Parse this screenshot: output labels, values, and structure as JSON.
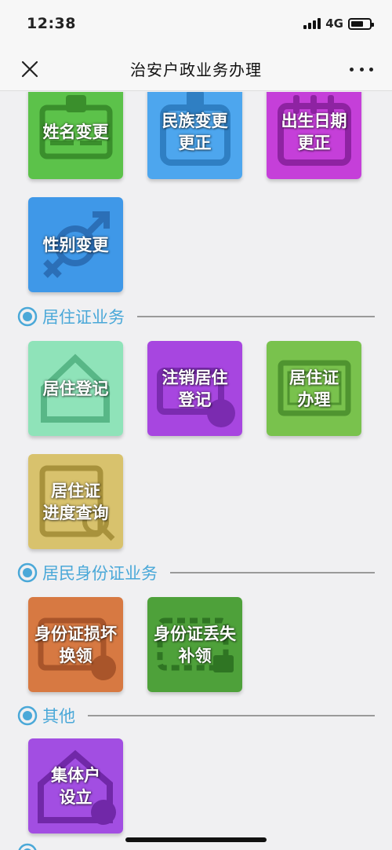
{
  "status": {
    "time": "12:38",
    "network": "4G"
  },
  "nav": {
    "title": "治安户政业务办理"
  },
  "tiles_name": [
    {
      "label": "姓名变更",
      "color": "#5cc24a",
      "icon": "id-card-icon"
    },
    {
      "label": "民族变更\n更正",
      "color": "#4da6ee",
      "icon": "badge-icon"
    },
    {
      "label": "出生日期\n更正",
      "color": "#c53fd9",
      "icon": "calendar-icon"
    },
    {
      "label": "性别变更",
      "color": "#3f98e8",
      "icon": "gender-icon"
    }
  ],
  "section_residence": {
    "title": "居住证业务"
  },
  "tiles_residence": [
    {
      "label": "居住登记",
      "color": "#8fe3b9",
      "icon": "house-icon"
    },
    {
      "label": "注销居住\n登记",
      "color": "#a746e0",
      "icon": "cancel-icon"
    },
    {
      "label": "居住证\n办理",
      "color": "#79c24d",
      "icon": "card-icon"
    },
    {
      "label": "居住证\n进度查询",
      "color": "#d8c26d",
      "icon": "magnifier-icon"
    }
  ],
  "section_idcard": {
    "title": "居民身份证业务"
  },
  "tiles_idcard": [
    {
      "label": "身份证损坏\n换领",
      "color": "#d77942",
      "icon": "exchange-icon"
    },
    {
      "label": "身份证丢失\n补领",
      "color": "#4ea13a",
      "icon": "supplement-icon"
    }
  ],
  "section_other": {
    "title": "其他"
  },
  "tiles_other": [
    {
      "label": "集体户\n设立",
      "color": "#a24ee2",
      "icon": "collective-icon"
    }
  ]
}
